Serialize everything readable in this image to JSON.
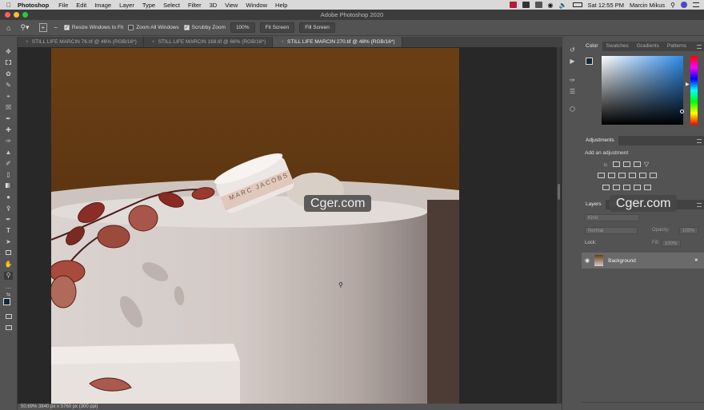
{
  "menubar": {
    "app": "Photoshop",
    "items": [
      "File",
      "Edit",
      "Image",
      "Layer",
      "Type",
      "Select",
      "Filter",
      "3D",
      "View",
      "Window",
      "Help"
    ],
    "clock": "Sat 12:55 PM",
    "user": "Marcin Mikus"
  },
  "window": {
    "title": "Adobe Photoshop 2020"
  },
  "options": {
    "resize_windows": "Resize Windows to Fit",
    "zoom_all": "Zoom All Windows",
    "scrubby_zoom": "Scrubby Zoom",
    "zoom_100": "100%",
    "fit_screen": "Fit Screen",
    "fill_screen": "Fill Screen"
  },
  "tabs": [
    {
      "label": "STILL LIFE MARCIN 76.tif @ 46% (RGB/16*)"
    },
    {
      "label": "STILL LIFE MARCIN 168.tif @ 66% (RGB/16*)"
    },
    {
      "label": "STILL LIFE MARCIN 270.tif @ 48% (RGB/16*)"
    }
  ],
  "canvas": {
    "product_label": "MARC JACOBS"
  },
  "status": {
    "text": "50.69%    3840 px x 5760 px (300 ppi)"
  },
  "color_panel": {
    "tabs": [
      "Color",
      "Swatches",
      "Gradients",
      "Patterns"
    ]
  },
  "adjustments_panel": {
    "title": "Adjustments",
    "hint": "Add an adjustment"
  },
  "layers_panel": {
    "tabs": [
      "Layers",
      "Cha"
    ],
    "kind_placeholder": "Kind",
    "blend_mode": "Normal",
    "opacity_label": "Opacity:",
    "opacity_value": "100%",
    "lock_label": "Lock:",
    "fill_label": "Fill:",
    "fill_value": "100%",
    "layer_name": "Background"
  },
  "watermark": {
    "text": "Cger.com"
  },
  "colors": {
    "accent": "#2d8ceb",
    "foreground": "#0f2a3a",
    "background": "#ffffff"
  }
}
